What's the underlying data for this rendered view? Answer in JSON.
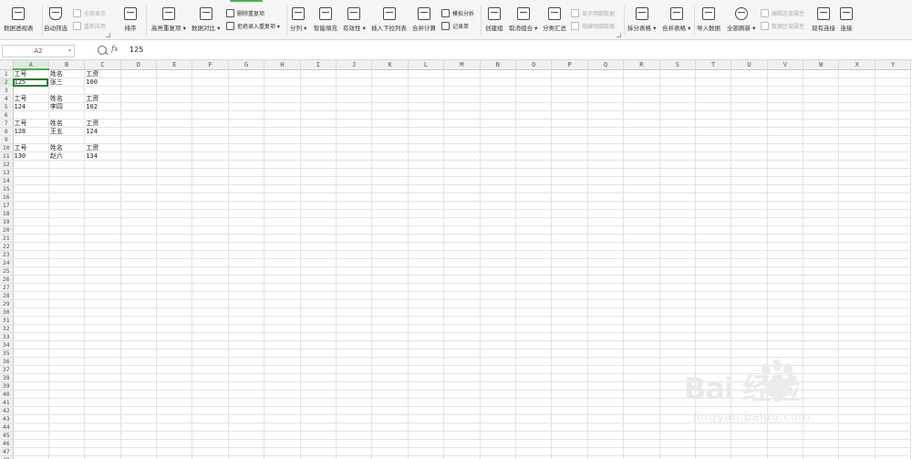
{
  "ribbon": {
    "tools": [
      {
        "id": "pivot",
        "label": "数据透视表",
        "icon": "pivot-table-icon"
      },
      {
        "id": "autofilter",
        "label": "自动筛选",
        "icon": "funnel-icon"
      },
      {
        "id": "sort",
        "label": "排序",
        "icon": "sort-az-icon"
      },
      {
        "id": "highlight",
        "label": "高亮重复项 ▾",
        "icon": "highlight-duplicates-icon"
      },
      {
        "id": "compare",
        "label": "数据对比 ▾",
        "icon": "data-compare-icon"
      },
      {
        "id": "split",
        "label": "分列 ▾",
        "icon": "split-column-icon"
      },
      {
        "id": "smartfill",
        "label": "智能填充",
        "icon": "smart-fill-icon"
      },
      {
        "id": "validity",
        "label": "有效性 ▾",
        "icon": "validity-icon"
      },
      {
        "id": "dropdown",
        "label": "插入下拉列表",
        "icon": "dropdown-list-icon"
      },
      {
        "id": "consolidate",
        "label": "合并计算",
        "icon": "consolidate-icon"
      },
      {
        "id": "group",
        "label": "创建组",
        "icon": "group-icon"
      },
      {
        "id": "ungroup",
        "label": "取消组合 ▾",
        "icon": "ungroup-icon"
      },
      {
        "id": "subtotal",
        "label": "分类汇总",
        "icon": "subtotal-icon"
      },
      {
        "id": "splittable",
        "label": "拆分表格 ▾",
        "icon": "split-table-icon"
      },
      {
        "id": "mergetable",
        "label": "合并表格 ▾",
        "icon": "merge-table-icon"
      },
      {
        "id": "import",
        "label": "导入数据",
        "icon": "import-data-icon"
      },
      {
        "id": "refresh",
        "label": "全部刷新 ▾",
        "icon": "refresh-icon"
      },
      {
        "id": "connections",
        "label": "现有连接",
        "icon": "existing-connections-icon"
      },
      {
        "id": "connect",
        "label": "连接",
        "icon": "connect-icon"
      }
    ],
    "small_tools": [
      {
        "id": "showall",
        "label": "全部显示",
        "disabled": true
      },
      {
        "id": "reapply",
        "label": "重新应用",
        "disabled": true
      },
      {
        "id": "removedup",
        "label": "删除重复项",
        "disabled": false
      },
      {
        "id": "rejectdup",
        "label": "拒绝录入重复项 ▾",
        "disabled": false
      },
      {
        "id": "whatif",
        "label": "模拟分析",
        "disabled": false
      },
      {
        "id": "record",
        "label": "记录单",
        "disabled": false
      },
      {
        "id": "showdetail",
        "label": "显示明细数据",
        "disabled": true
      },
      {
        "id": "hidedetail",
        "label": "隐藏明细数据",
        "disabled": true
      },
      {
        "id": "editconn",
        "label": "编辑连接属性",
        "disabled": true
      },
      {
        "id": "rangeprops",
        "label": "数据区域属性",
        "disabled": true
      }
    ]
  },
  "formula_bar": {
    "name_box": "A2",
    "fx_label": "fx",
    "value": "125"
  },
  "grid": {
    "columns": [
      "A",
      "B",
      "C",
      "D",
      "E",
      "F",
      "G",
      "H",
      "I",
      "J",
      "K",
      "L",
      "M",
      "N",
      "O",
      "P",
      "Q",
      "R",
      "S",
      "T",
      "U",
      "V",
      "W",
      "X",
      "Y"
    ],
    "row_count": 49,
    "active_cell": "A2",
    "cells": [
      [
        "工号",
        "姓名",
        "工资"
      ],
      [
        "125",
        "张三",
        "100"
      ],
      [
        "",
        "",
        ""
      ],
      [
        "工号",
        "姓名",
        "工资"
      ],
      [
        "124",
        "李四",
        "102"
      ],
      [
        "",
        "",
        ""
      ],
      [
        "工号",
        "姓名",
        "工资"
      ],
      [
        "128",
        "王五",
        "124"
      ],
      [
        "",
        "",
        ""
      ],
      [
        "工号",
        "姓名",
        "工资"
      ],
      [
        "130",
        "赵六",
        "134"
      ]
    ]
  },
  "watermark": {
    "brand": "Bai  经验",
    "url": "jingyan.baidu.com"
  }
}
